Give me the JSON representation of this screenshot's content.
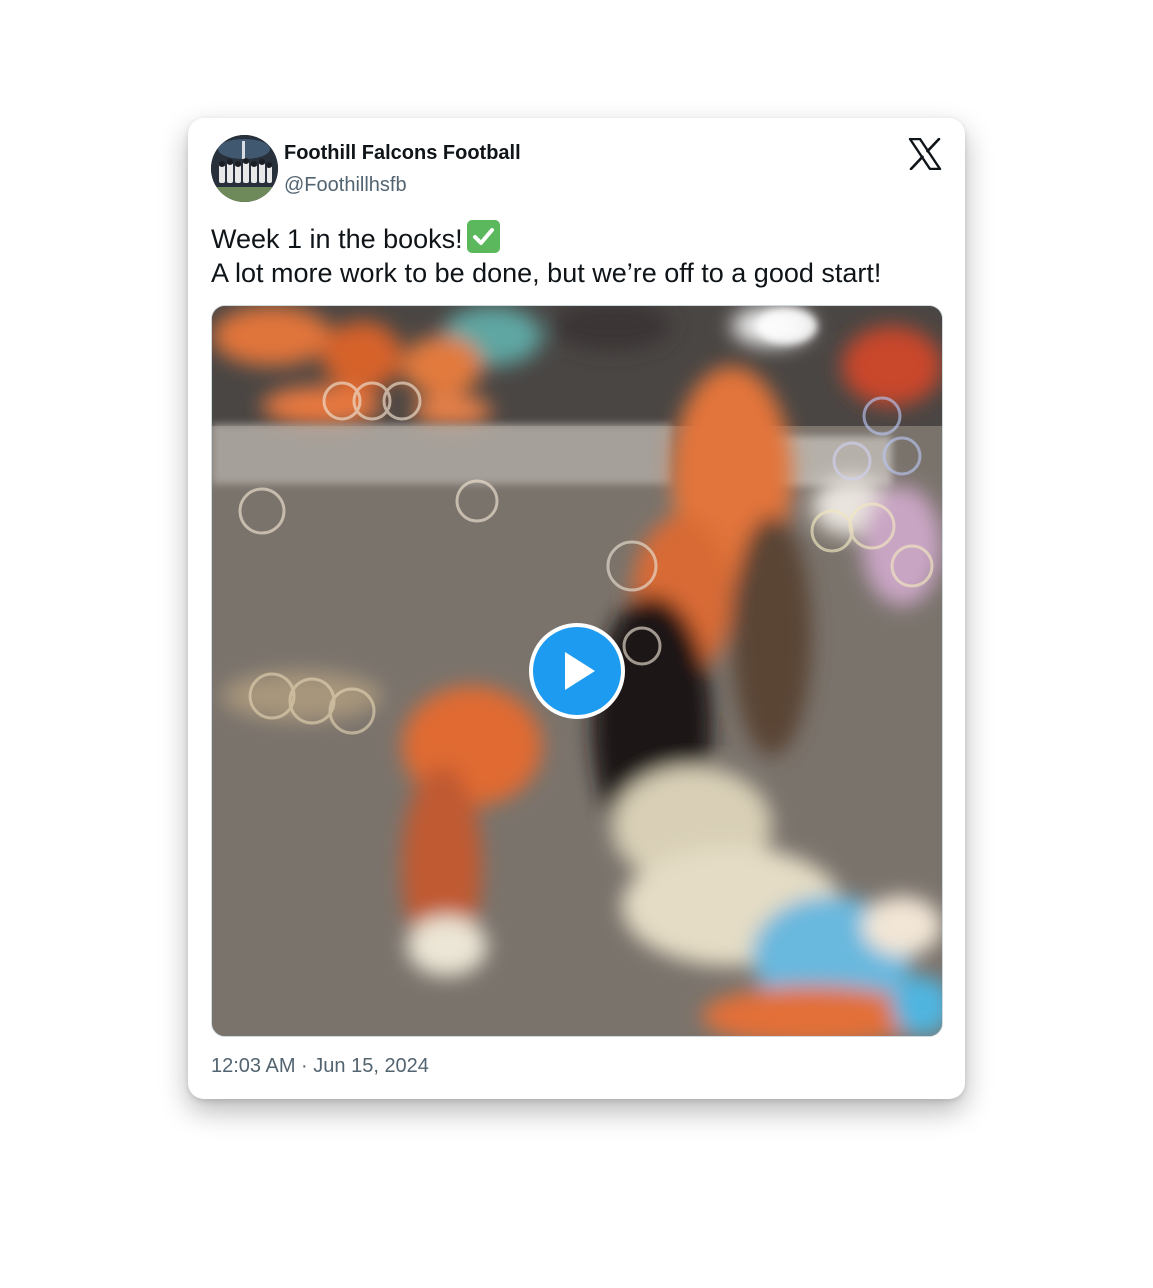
{
  "tweet": {
    "author_name": "Foothill Falcons Football",
    "author_handle": "@Foothillhsfb",
    "text_line1": "Week 1 in the books!",
    "text_line2": "A lot more work to be done, but we’re off to a good start!",
    "emoji": "check-mark-button-icon",
    "timestamp": "12:03 AM · Jun 15, 2024"
  },
  "icons": {
    "platform_logo": "x-logo-icon",
    "play": "play-icon"
  },
  "colors": {
    "accent": "#1d9bf0",
    "text_primary": "#0f1419",
    "text_secondary": "#536471",
    "emoji_green": "#5cb85c"
  }
}
